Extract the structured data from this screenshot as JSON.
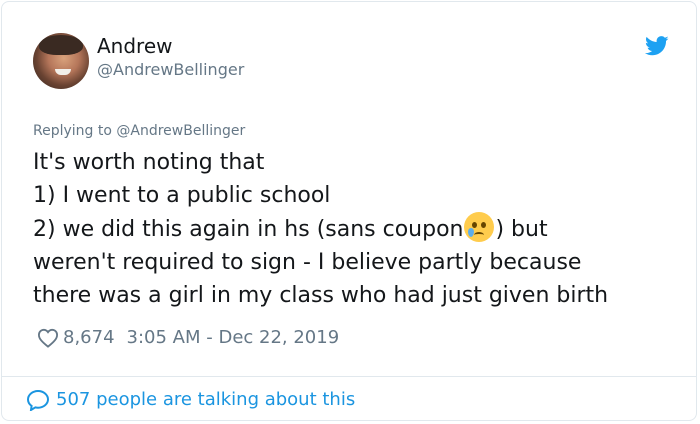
{
  "tweet": {
    "author_name": "Andrew",
    "author_handle": "@AndrewBellinger",
    "replying_prefix": "Replying to",
    "replying_to": "@AndrewBellinger",
    "lines": [
      "It's worth noting that",
      "1) I went to a public school",
      "2) we did this again in hs (sans coupon",
      ") but",
      "weren't required to sign - I believe partly because",
      "there was a girl in my class who had just given birth"
    ],
    "emoji": "crying-face",
    "likes": "8,674",
    "timestamp": "3:05 AM - Dec 22, 2019",
    "talking": "507 people are talking about this"
  },
  "icons": {
    "brand": "twitter-bird-icon",
    "like": "heart-icon",
    "talk": "speech-bubble-icon"
  },
  "colors": {
    "twitter_blue": "#1da1f2",
    "link_blue": "#1b95e0",
    "text": "#14171a",
    "muted": "#657786"
  }
}
